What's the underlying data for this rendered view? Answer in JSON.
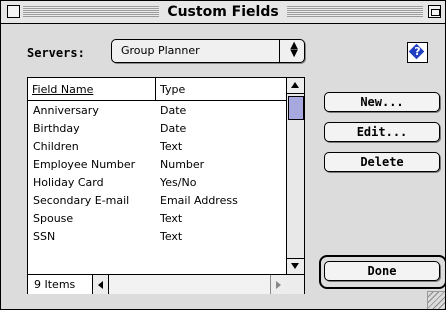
{
  "window": {
    "title": "Custom Fields"
  },
  "servers": {
    "label": "Servers:",
    "selected": "Group Planner"
  },
  "list": {
    "headers": {
      "field_name": "Field Name",
      "type": "Type"
    },
    "rows": [
      {
        "name": "Anniversary",
        "type": "Date"
      },
      {
        "name": "Birthday",
        "type": "Date"
      },
      {
        "name": "Children",
        "type": "Text"
      },
      {
        "name": "Employee Number",
        "type": "Number"
      },
      {
        "name": "Holiday Card",
        "type": "Yes/No"
      },
      {
        "name": "Secondary E-mail",
        "type": "Email Address"
      },
      {
        "name": "Spouse",
        "type": "Text"
      },
      {
        "name": "SSN",
        "type": "Text"
      }
    ],
    "count_label": "9 Items"
  },
  "buttons": {
    "new": "New...",
    "edit": "Edit...",
    "delete": "Delete",
    "done": "Done"
  },
  "icons": {
    "help": "help-icon",
    "close": "close-box-icon",
    "zoom": "zoom-box-icon",
    "popup": "up-down-arrows-icon",
    "grow": "grow-box-icon"
  },
  "colors": {
    "scroll_thumb": "#a7a8de",
    "help_icon": "#1f3fc0"
  }
}
